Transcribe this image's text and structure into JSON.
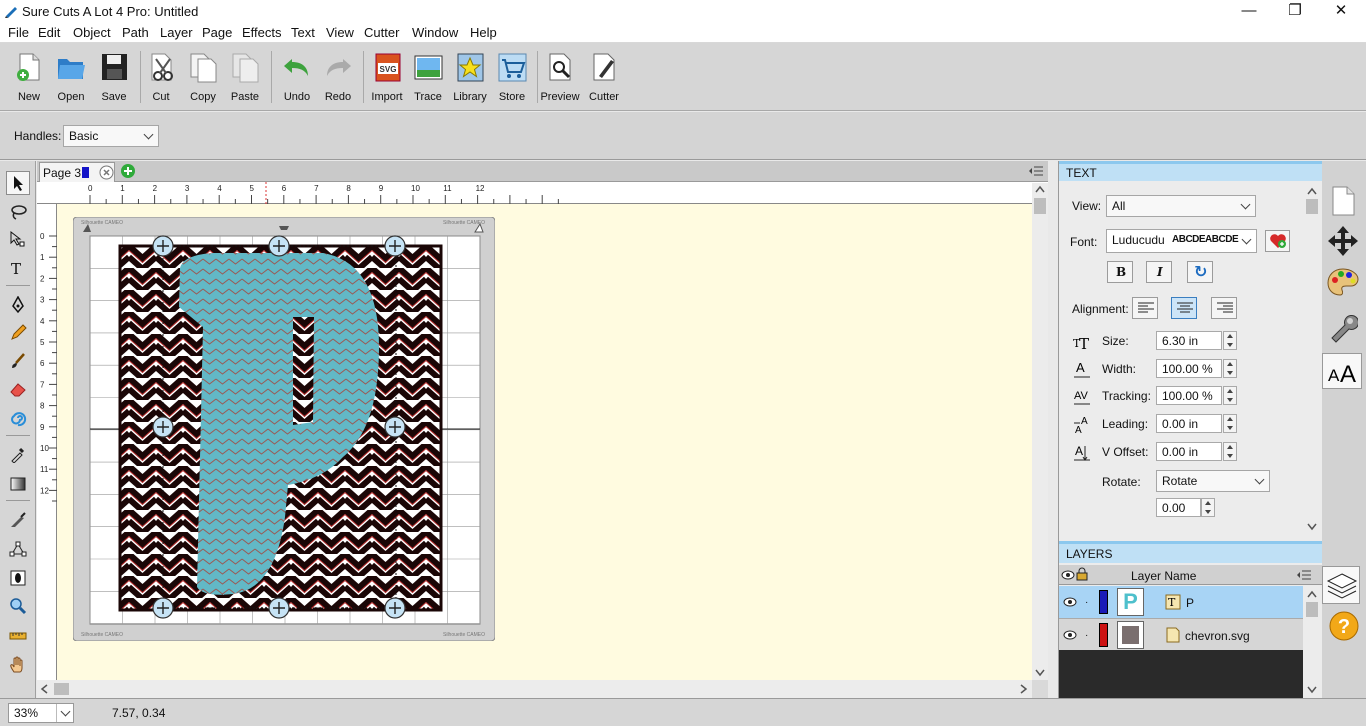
{
  "window": {
    "title": "Sure Cuts A Lot 4 Pro: Untitled",
    "minimize": "—",
    "maximize": "❐",
    "close": "✕"
  },
  "menu": [
    "File",
    "Edit",
    "Object",
    "Path",
    "Layer",
    "Page",
    "Effects",
    "Text",
    "View",
    "Cutter",
    "Window",
    "Help"
  ],
  "toolbar": [
    "New",
    "Open",
    "Save",
    "Cut",
    "Copy",
    "Paste",
    "Undo",
    "Redo",
    "Import",
    "Trace",
    "Library",
    "Store",
    "Preview",
    "Cutter"
  ],
  "options": {
    "handles_label": "Handles:",
    "handles_value": "Basic"
  },
  "page_tab": {
    "label": "Page 3"
  },
  "ruler": {
    "h_ticks": [
      "0",
      "1",
      "2",
      "3",
      "4",
      "5",
      "6",
      "7",
      "8",
      "9",
      "10",
      "11",
      "12"
    ],
    "v_ticks": [
      "0",
      "1",
      "2",
      "3",
      "4",
      "5",
      "6",
      "7",
      "8",
      "9",
      "10",
      "11",
      "12"
    ]
  },
  "mat": {
    "brand": "Silhouette CAMEO"
  },
  "text_panel": {
    "title": "TEXT",
    "view_label": "View:",
    "view_value": "All",
    "font_label": "Font:",
    "font_name": "Luducudu",
    "font_preview": "ABCDEABCDE",
    "bold": "B",
    "italic": "I",
    "refresh": "↻",
    "alignment_label": "Alignment:",
    "size_label": "Size:",
    "size_value": "6.30 in",
    "width_label": "Width:",
    "width_value": "100.00 %",
    "tracking_label": "Tracking:",
    "tracking_value": "100.00 %",
    "leading_label": "Leading:",
    "leading_value": "0.00 in",
    "voffset_label": "V Offset:",
    "voffset_value": "0.00 in",
    "rotate_label": "Rotate:",
    "rotate_mode": "Rotate",
    "rotate_value": "0.00"
  },
  "layers_panel": {
    "title": "LAYERS",
    "column": "Layer Name",
    "rows": [
      {
        "name": "P",
        "color": "#1a1ab8",
        "thumb": "P"
      },
      {
        "name": "chevron.svg",
        "color": "#cc1111",
        "thumb": ""
      }
    ]
  },
  "status": {
    "zoom": "33%",
    "coords": "7.57, 0.34"
  },
  "colors": {
    "teal": "#62b8c6",
    "chevron_dark": "#1a0606",
    "paper": "#fffbe0",
    "mat": "#d0d0d0",
    "selected_row": "#a8d4f5"
  }
}
